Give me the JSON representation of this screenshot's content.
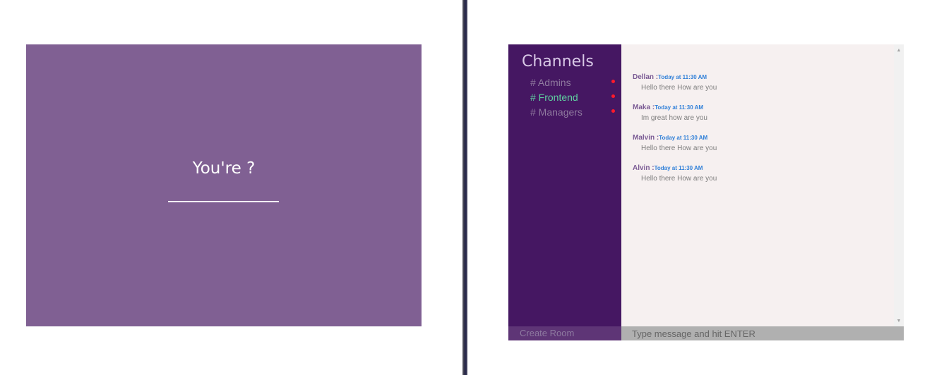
{
  "login": {
    "prompt": "You're ?",
    "name_value": "",
    "background_color": "#806093"
  },
  "chat": {
    "sidebar": {
      "title": "Channels",
      "channels": [
        {
          "label": "# Admins",
          "active": false,
          "unread": true
        },
        {
          "label": "# Frontend",
          "active": true,
          "unread": true
        },
        {
          "label": "# Managers",
          "active": false,
          "unread": true
        }
      ],
      "create_room_label": "Create Room"
    },
    "messages": [
      {
        "author": "Dellan :",
        "time": "Today at 11:30 AM",
        "text": "Hello there How are you"
      },
      {
        "author": "Maka :",
        "time": "Today at 11:30 AM",
        "text": "Im great how are you"
      },
      {
        "author": "Malvin :",
        "time": "Today at 11:30 AM",
        "text": "Hello there How are you"
      },
      {
        "author": "Alvin :",
        "time": "Today at 11:30 AM",
        "text": "Hello there How are you"
      }
    ],
    "composer": {
      "placeholder": "Type message and hit ENTER",
      "value": ""
    },
    "colors": {
      "sidebar": "#451762",
      "active_channel": "#5fd1a0",
      "unread_dot": "#ff1a2a",
      "timestamp": "#2f7fd8",
      "author": "#7a5a94"
    }
  }
}
